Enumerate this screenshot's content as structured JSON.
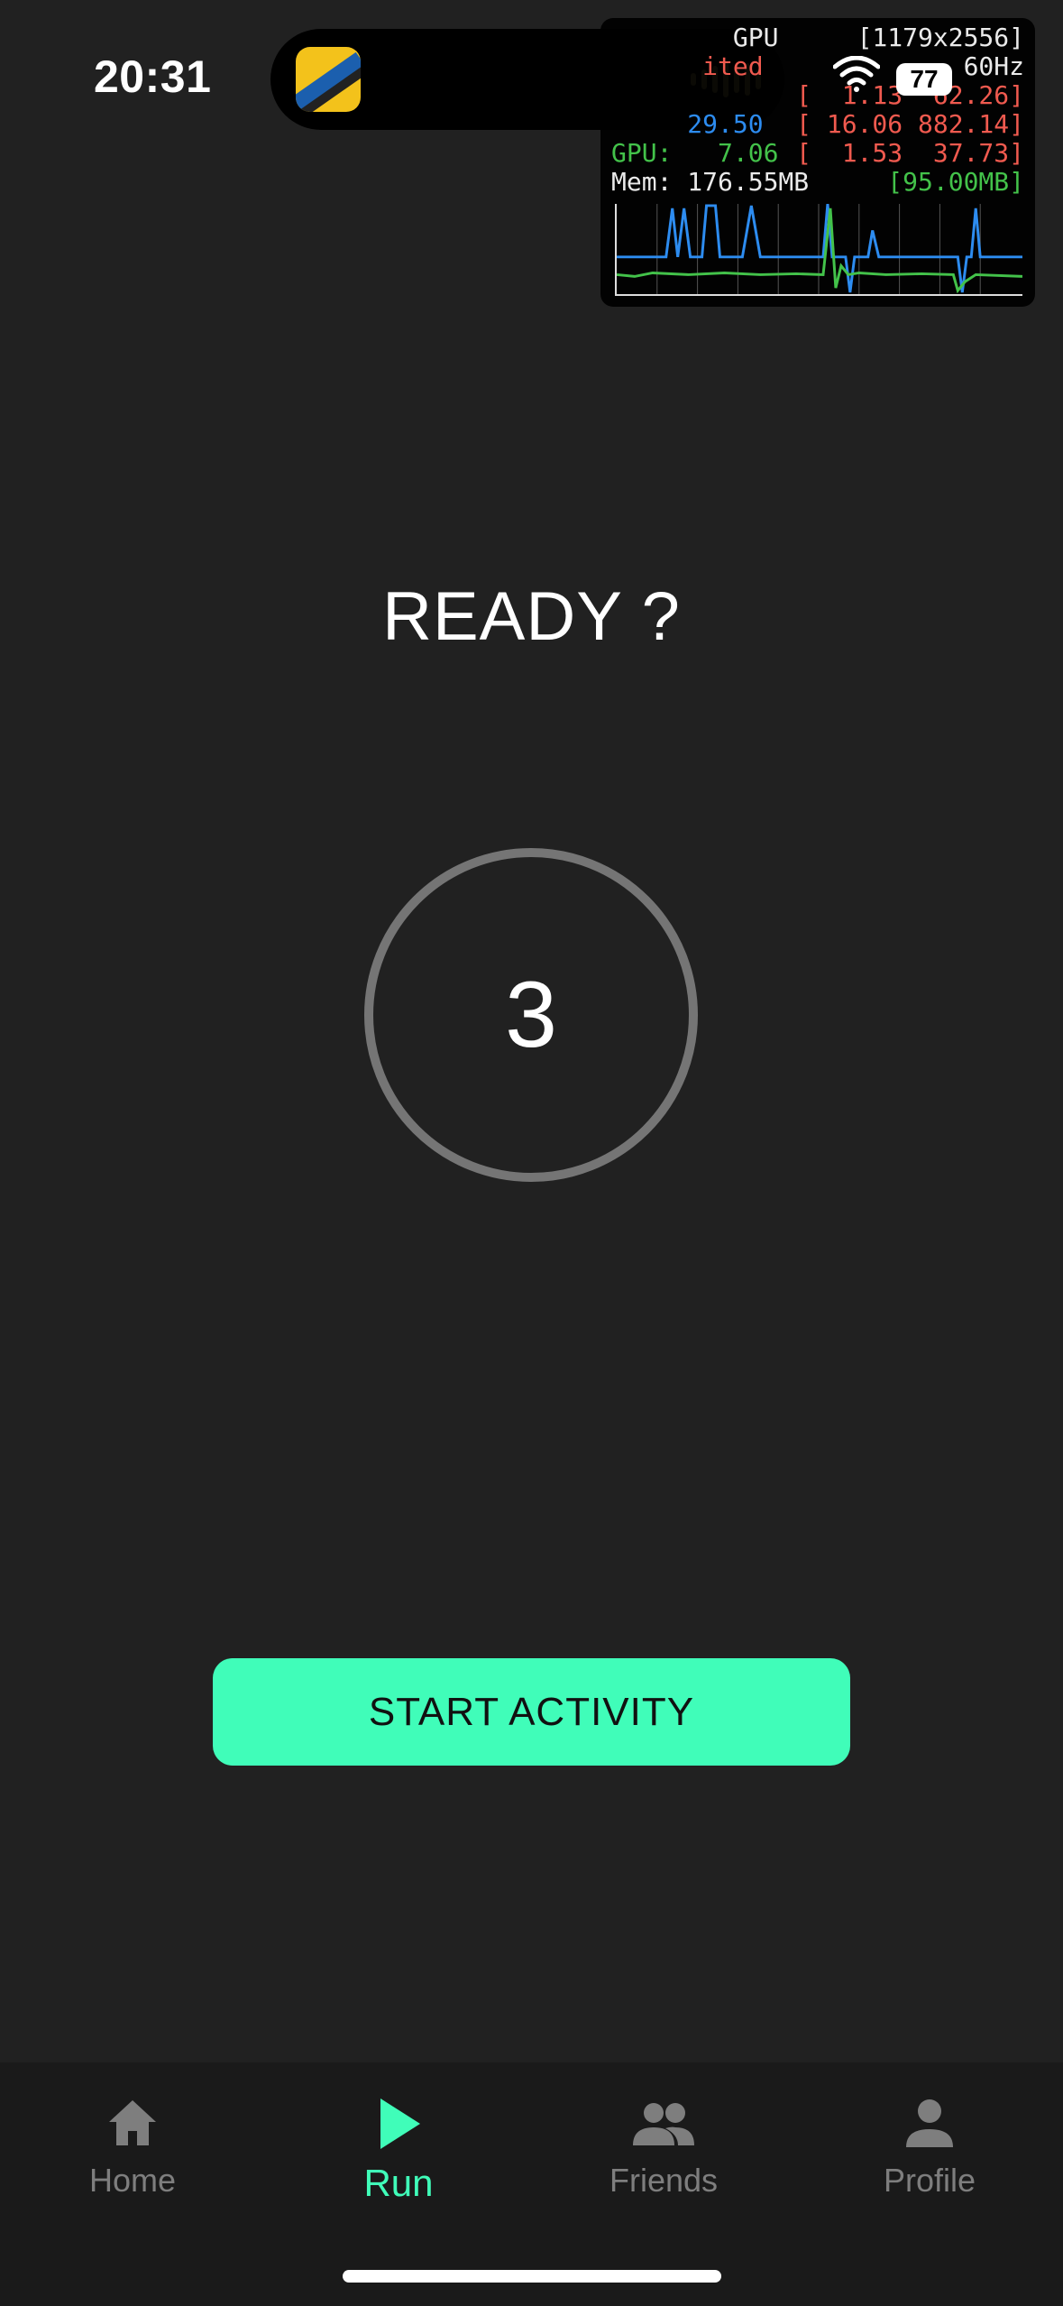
{
  "status_bar": {
    "time": "20:31",
    "battery": "77"
  },
  "hud": {
    "lines": [
      {
        "left": "        GPU",
        "right": "[1179x2556]",
        "left_color": "white",
        "right_color": "white"
      },
      {
        "left": "      ited",
        "right": "60Hz",
        "left_color": "red",
        "right_color": "white"
      },
      {
        "left": "",
        "right": "[  1.13  62.26]",
        "left_color": "white",
        "right_color": "red"
      },
      {
        "left": "     29.50",
        "right": "[ 16.06 882.14]",
        "left_color": "blue",
        "right_color": "red"
      },
      {
        "left": "GPU:   7.06",
        "right": "[  1.53  37.73]",
        "left_color": "green",
        "right_color": "red"
      },
      {
        "left": "Mem: 176.55MB",
        "right": "[95.00MB]",
        "left_color": "white",
        "right_color": "green"
      }
    ]
  },
  "main": {
    "title": "READY ?",
    "countdown": "3",
    "start_button": "START ACTIVITY"
  },
  "nav": {
    "items": [
      {
        "label": "Home",
        "icon": "home-icon"
      },
      {
        "label": "Run",
        "icon": "play-icon",
        "active": true
      },
      {
        "label": "Friends",
        "icon": "friends-icon"
      },
      {
        "label": "Profile",
        "icon": "profile-icon"
      }
    ]
  },
  "colors": {
    "background": "#212121",
    "accent": "#40fdb9",
    "nav_inactive": "#7e7e7e"
  }
}
